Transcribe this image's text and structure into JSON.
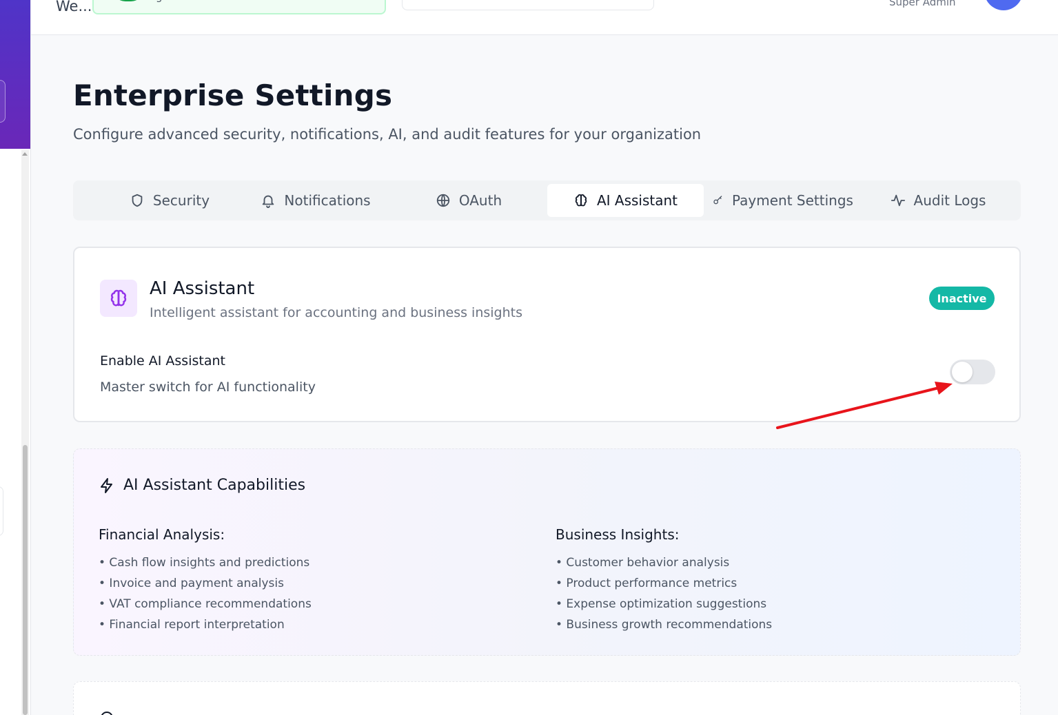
{
  "header": {
    "title": "We...",
    "company_name": "general",
    "user_role": "Super Admin"
  },
  "page": {
    "title": "Enterprise Settings",
    "subtitle": "Configure advanced security, notifications, AI, and audit features for your organization"
  },
  "tabs": [
    {
      "label": "Security",
      "icon": "shield-icon",
      "active": false
    },
    {
      "label": "Notifications",
      "icon": "bell-icon",
      "active": false
    },
    {
      "label": "OAuth",
      "icon": "globe-icon",
      "active": false
    },
    {
      "label": "AI Assistant",
      "icon": "brain-icon",
      "active": true
    },
    {
      "label": "Payment Settings",
      "icon": "key-icon",
      "active": false
    },
    {
      "label": "Audit Logs",
      "icon": "activity-icon",
      "active": false
    }
  ],
  "ai_card": {
    "title": "AI Assistant",
    "description": "Intelligent assistant for accounting and business insights",
    "status": "Inactive",
    "status_color": "#14b8a6",
    "enable_label": "Enable AI Assistant",
    "enable_description": "Master switch for AI functionality",
    "enabled": false
  },
  "capabilities": {
    "title": "AI Assistant Capabilities",
    "financial": {
      "title": "Financial Analysis:",
      "items": [
        "• Cash flow insights and predictions",
        "• Invoice and payment analysis",
        "• VAT compliance recommendations",
        "• Financial report interpretation"
      ]
    },
    "business": {
      "title": "Business Insights:",
      "items": [
        "• Customer behavior analysis",
        "• Product performance metrics",
        "• Expense optimization suggestions",
        "• Business growth recommendations"
      ]
    }
  },
  "colors": {
    "accent_purple": "#9333ea",
    "annotation_arrow": "#e8141b"
  }
}
